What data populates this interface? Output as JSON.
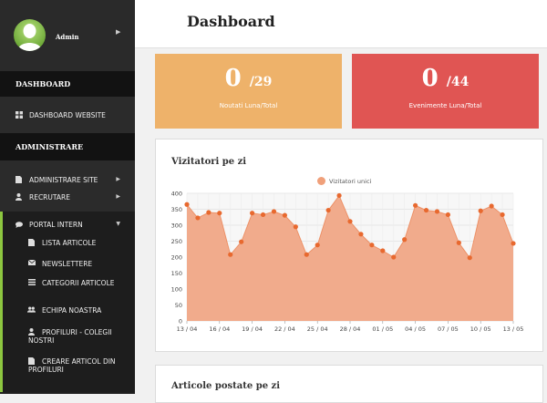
{
  "sidebar": {
    "user_name": "Admin",
    "sections": {
      "dashboard": "DASHBOARD",
      "administrare": "ADMINISTRARE"
    },
    "items": {
      "dashboard_website": "DASHBOARD WEBSITE",
      "administrare_site": "ADMINISTRARE SITE",
      "recrutare": "RECRUTARE",
      "portal_intern": "PORTAL INTERN"
    },
    "sub_items": {
      "lista_articole": "LISTA ARTICOLE",
      "newslettere": "NEWSLETTERE",
      "categorii_articole": "CATEGORII ARTICOLE",
      "echipa_noastra": "ECHIPA NOASTRA",
      "profiluri_colegii": "PROFILURI - COLEGII NOSTRI",
      "creare_articol": "CREARE ARTICOL DIN PROFILURI"
    }
  },
  "header": {
    "title": "Dashboard"
  },
  "stats": [
    {
      "value": "0",
      "total": "/29",
      "label": "Noutati Luna/Total",
      "color": "#eeb26a"
    },
    {
      "value": "0",
      "total": "/44",
      "label": "Evenimente Luna/Total",
      "color": "#e05553"
    }
  ],
  "panels": {
    "visitors_title": "Vizitatori pe zi",
    "articles_title": "Articole postate pe zi"
  },
  "chart_data": {
    "type": "area",
    "title": "Vizitatori pe zi",
    "series": [
      {
        "name": "Vizitatori unici",
        "values": [
          365,
          323,
          340,
          338,
          208,
          248,
          338,
          333,
          343,
          331,
          295,
          208,
          238,
          347,
          393,
          312,
          272,
          238,
          220,
          200,
          255,
          362,
          347,
          343,
          333,
          245,
          198,
          345,
          360,
          333,
          243
        ]
      }
    ],
    "x_tick_labels": [
      "13 / 04",
      "16 / 04",
      "19 / 04",
      "22 / 04",
      "25 / 04",
      "28 / 04",
      "01 / 05",
      "04 / 05",
      "07 / 05",
      "10 / 05",
      "13 / 05"
    ],
    "x_tick_every": 3,
    "y_ticks": [
      0,
      50,
      100,
      150,
      200,
      250,
      300,
      350,
      400
    ],
    "ylim": [
      0,
      400
    ],
    "grid": true,
    "legend": "top-center",
    "line_color": "#e8692f",
    "fill_color": "#f1ab8c"
  }
}
